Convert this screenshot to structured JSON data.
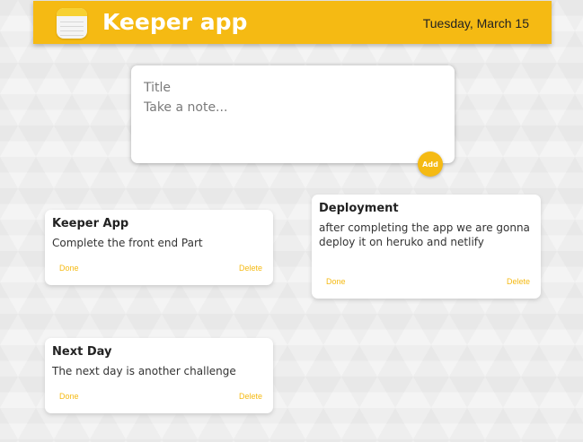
{
  "header": {
    "title": "Keeper app",
    "date": "Tuesday, March 15"
  },
  "create_note": {
    "title_placeholder": "Title",
    "content_placeholder": "Take a note...",
    "add_label": "Add"
  },
  "notes": [
    {
      "title": "Keeper App",
      "content": "Complete the front end Part",
      "done_label": "Done",
      "delete_label": "Delete"
    },
    {
      "title": "Deployment",
      "content": "after completing the app we are gonna deploy it on heruko and netlify",
      "done_label": "Done",
      "delete_label": "Delete"
    },
    {
      "title": "Next Day",
      "content": "The next day is another challenge",
      "done_label": "Done",
      "delete_label": "Delete"
    }
  ],
  "colors": {
    "accent": "#f5ba13"
  }
}
